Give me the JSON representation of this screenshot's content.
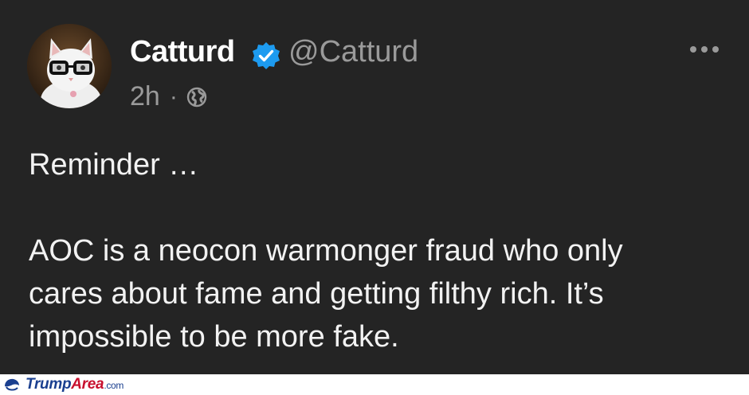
{
  "post": {
    "author_name": "Catturd",
    "handle": "@Catturd",
    "time": "2h",
    "separator": "·",
    "text_lines": [
      "Reminder …",
      "",
      "AOC is a neocon warmonger fraud who only",
      "cares about fame and getting filthy rich. It’s",
      "impossible to be more fake."
    ]
  },
  "icons": {
    "verified": "verified-badge-icon",
    "visibility": "globe-icon",
    "more": "more-options-icon"
  },
  "watermark": {
    "brand_a": "Trump",
    "brand_b": "Area",
    "suffix": ".com"
  },
  "colors": {
    "background": "#242424",
    "verified_blue": "#1d9bf0",
    "muted_text": "#9a9a9a",
    "text": "#f2f2f2",
    "watermark_blue": "#1a3f8f",
    "watermark_red": "#c8102e"
  }
}
